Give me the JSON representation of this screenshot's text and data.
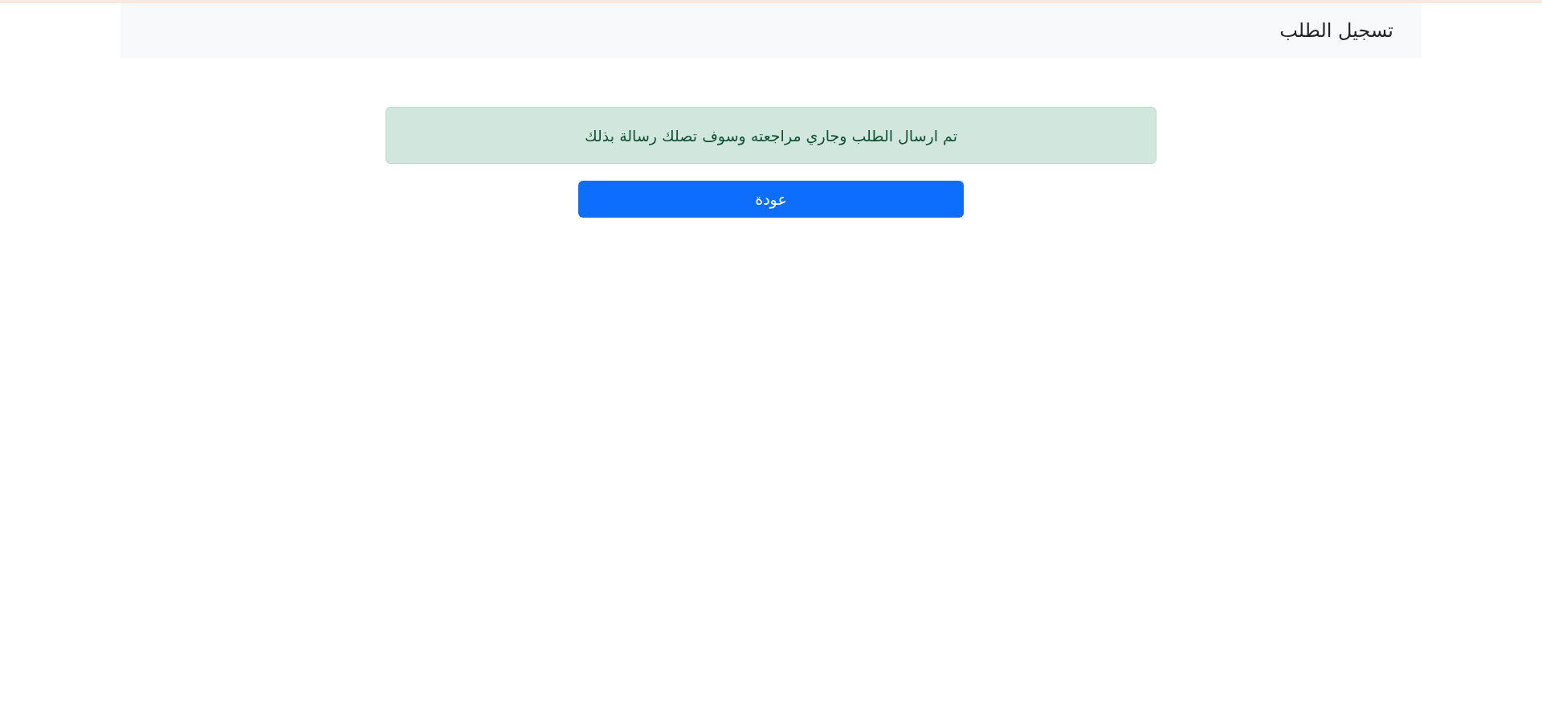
{
  "header": {
    "title": "تسجيل الطلب"
  },
  "alert": {
    "message": "تم ارسال الطلب وجاري مراجعته وسوف تصلك رسالة بذلك"
  },
  "back_button": {
    "label": "عودة"
  }
}
